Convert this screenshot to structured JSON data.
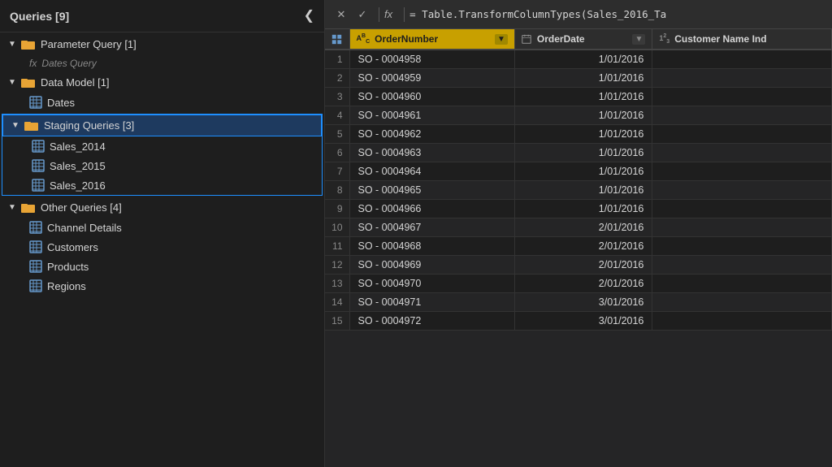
{
  "sidebar": {
    "title": "Queries [9]",
    "collapse_label": "❮",
    "groups": [
      {
        "id": "parameter-query",
        "label": "Parameter Query [1]",
        "expanded": true,
        "selected": false,
        "children": [
          {
            "id": "dates-query",
            "label": "Dates Query",
            "type": "fx",
            "selected": false
          }
        ]
      },
      {
        "id": "data-model",
        "label": "Data Model [1]",
        "expanded": true,
        "selected": false,
        "children": [
          {
            "id": "dates",
            "label": "Dates",
            "type": "table",
            "selected": false
          }
        ]
      },
      {
        "id": "staging-queries",
        "label": "Staging Queries [3]",
        "expanded": true,
        "selected": true,
        "children": [
          {
            "id": "sales-2014",
            "label": "Sales_2014",
            "type": "table",
            "selected": false
          },
          {
            "id": "sales-2015",
            "label": "Sales_2015",
            "type": "table",
            "selected": false
          },
          {
            "id": "sales-2016",
            "label": "Sales_2016",
            "type": "table",
            "selected": false
          }
        ]
      },
      {
        "id": "other-queries",
        "label": "Other Queries [4]",
        "expanded": true,
        "selected": false,
        "children": [
          {
            "id": "channel-details",
            "label": "Channel Details",
            "type": "table",
            "selected": false
          },
          {
            "id": "customers",
            "label": "Customers",
            "type": "table",
            "selected": false
          },
          {
            "id": "products",
            "label": "Products",
            "type": "table",
            "selected": false
          },
          {
            "id": "regions",
            "label": "Regions",
            "type": "table",
            "selected": false
          }
        ]
      }
    ]
  },
  "formula_bar": {
    "cancel_label": "✕",
    "confirm_label": "✓",
    "fx_label": "fx",
    "formula_text": "= Table.TransformColumnTypes(Sales_2016_Ta"
  },
  "table": {
    "columns": [
      {
        "id": "order-number",
        "label": "OrderNumber",
        "type": "ABC",
        "highlighted": true
      },
      {
        "id": "order-date",
        "label": "OrderDate",
        "type": "calendar",
        "highlighted": false
      },
      {
        "id": "customer-name",
        "label": "Customer Name Ind",
        "type": "123",
        "highlighted": false
      }
    ],
    "rows": [
      {
        "num": 1,
        "order_number": "SO - 0004958",
        "order_date": "1/01/2016"
      },
      {
        "num": 2,
        "order_number": "SO - 0004959",
        "order_date": "1/01/2016"
      },
      {
        "num": 3,
        "order_number": "SO - 0004960",
        "order_date": "1/01/2016"
      },
      {
        "num": 4,
        "order_number": "SO - 0004961",
        "order_date": "1/01/2016"
      },
      {
        "num": 5,
        "order_number": "SO - 0004962",
        "order_date": "1/01/2016"
      },
      {
        "num": 6,
        "order_number": "SO - 0004963",
        "order_date": "1/01/2016"
      },
      {
        "num": 7,
        "order_number": "SO - 0004964",
        "order_date": "1/01/2016"
      },
      {
        "num": 8,
        "order_number": "SO - 0004965",
        "order_date": "1/01/2016"
      },
      {
        "num": 9,
        "order_number": "SO - 0004966",
        "order_date": "1/01/2016"
      },
      {
        "num": 10,
        "order_number": "SO - 0004967",
        "order_date": "2/01/2016"
      },
      {
        "num": 11,
        "order_number": "SO - 0004968",
        "order_date": "2/01/2016"
      },
      {
        "num": 12,
        "order_number": "SO - 0004969",
        "order_date": "2/01/2016"
      },
      {
        "num": 13,
        "order_number": "SO - 0004970",
        "order_date": "2/01/2016"
      },
      {
        "num": 14,
        "order_number": "SO - 0004971",
        "order_date": "3/01/2016"
      },
      {
        "num": 15,
        "order_number": "SO - 0004972",
        "order_date": "3/01/2016"
      }
    ]
  },
  "icons": {
    "folder": "folder",
    "table": "table",
    "fx": "fx"
  }
}
